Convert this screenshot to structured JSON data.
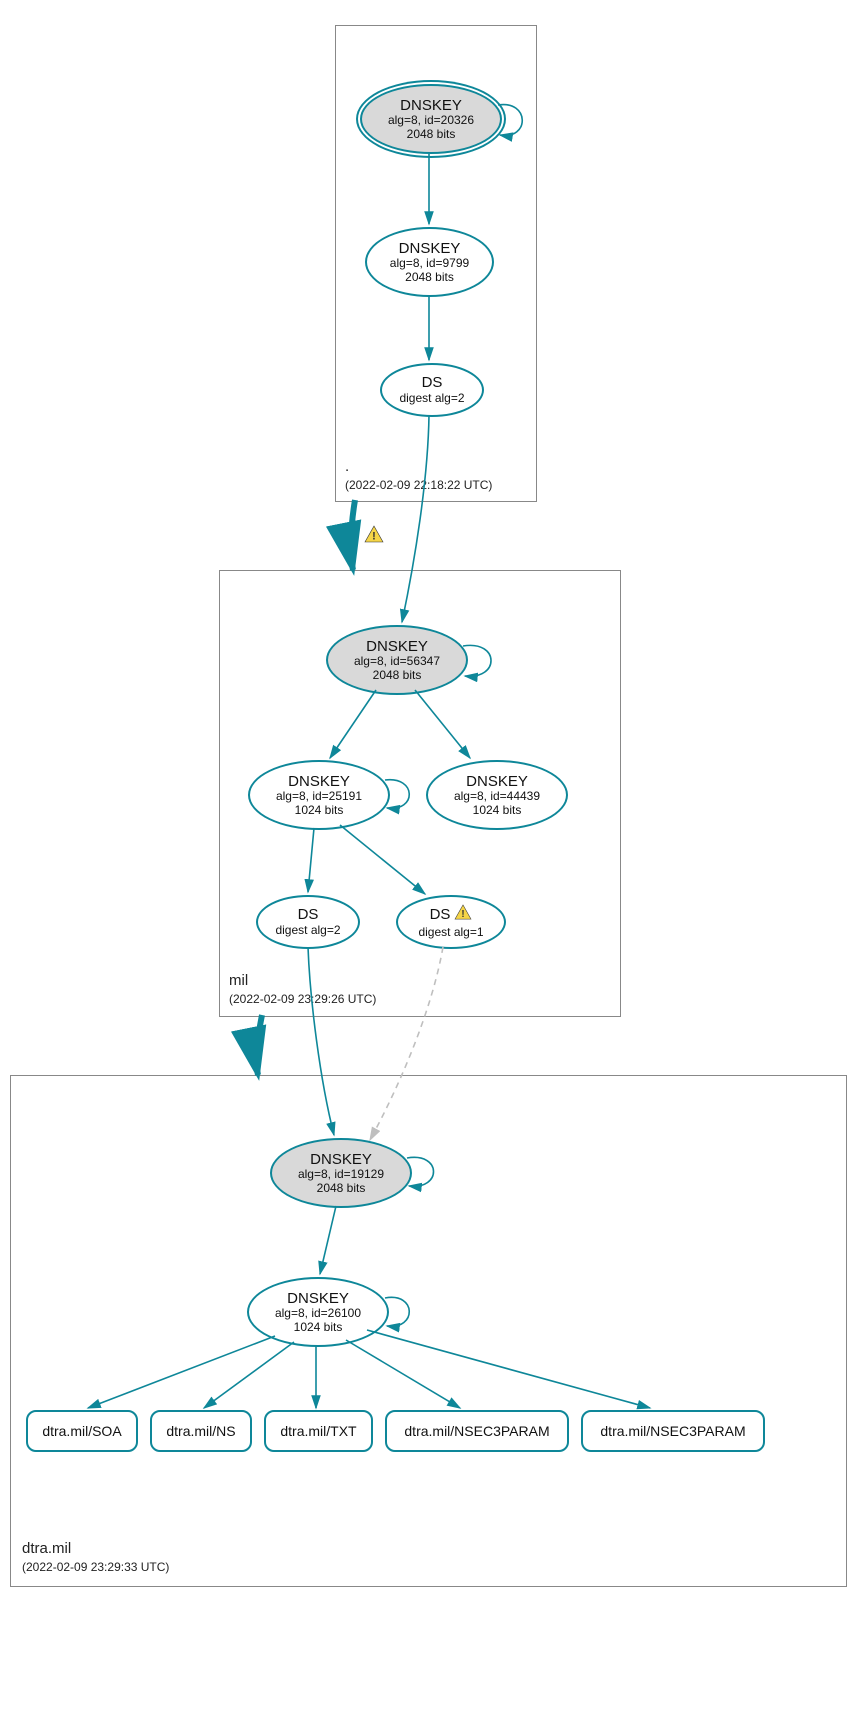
{
  "colors": {
    "teal": "#0e8799",
    "boxBorder": "#888888",
    "dashed": "#bfbfbf"
  },
  "zones": {
    "root": {
      "name": ".",
      "timestamp": "(2022-02-09 22:18:22 UTC)"
    },
    "mil": {
      "name": "mil",
      "timestamp": "(2022-02-09 23:29:26 UTC)"
    },
    "dtra": {
      "name": "dtra.mil",
      "timestamp": "(2022-02-09 23:29:33 UTC)"
    }
  },
  "nodes": {
    "root_ksk": {
      "title": "DNSKEY",
      "sub": "alg=8, id=20326",
      "sub2": "2048 bits"
    },
    "root_zsk": {
      "title": "DNSKEY",
      "sub": "alg=8, id=9799",
      "sub2": "2048 bits"
    },
    "root_ds": {
      "title": "DS",
      "sub": "digest alg=2"
    },
    "mil_ksk": {
      "title": "DNSKEY",
      "sub": "alg=8, id=56347",
      "sub2": "2048 bits"
    },
    "mil_zsk1": {
      "title": "DNSKEY",
      "sub": "alg=8, id=25191",
      "sub2": "1024 bits"
    },
    "mil_zsk2": {
      "title": "DNSKEY",
      "sub": "alg=8, id=44439",
      "sub2": "1024 bits"
    },
    "mil_ds1": {
      "title": "DS",
      "sub": "digest alg=2"
    },
    "mil_ds2": {
      "title": "DS",
      "sub": "digest alg=1"
    },
    "dtra_ksk": {
      "title": "DNSKEY",
      "sub": "alg=8, id=19129",
      "sub2": "2048 bits"
    },
    "dtra_zsk": {
      "title": "DNSKEY",
      "sub": "alg=8, id=26100",
      "sub2": "1024 bits"
    },
    "rr_soa": {
      "title": "dtra.mil/SOA"
    },
    "rr_ns": {
      "title": "dtra.mil/NS"
    },
    "rr_txt": {
      "title": "dtra.mil/TXT"
    },
    "rr_n3p1": {
      "title": "dtra.mil/NSEC3PARAM"
    },
    "rr_n3p2": {
      "title": "dtra.mil/NSEC3PARAM"
    }
  }
}
